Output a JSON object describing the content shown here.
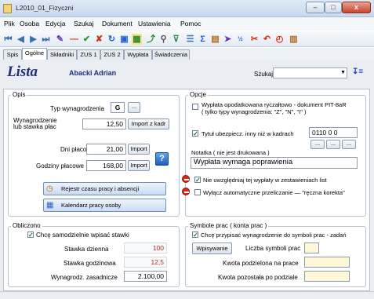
{
  "window": {
    "title": "L2010_01_Fizyczni"
  },
  "menu": [
    "Plik",
    "Osoba",
    "Edycja",
    "Szukaj",
    "Dokument",
    "Ustawienia",
    "Pomoc"
  ],
  "tabs": [
    "Spis",
    "Ogólne",
    "Składniki",
    "ZUS 1",
    "ZUS 2",
    "Wypłata",
    "Świadczenia"
  ],
  "header": {
    "logo": "Lista",
    "person": "Abacki Adrian",
    "search_label": "Szukaj",
    "search_value": ""
  },
  "opis": {
    "title": "Opis",
    "typ_label": "Typ wynagrodzenia",
    "typ_value": "G",
    "ellipsis": "...",
    "wyn_label1": "Wynagrodzenie",
    "wyn_label2": "lub stawka płac",
    "wyn_value": "12,50",
    "import_kadr": "Import z kadr",
    "dni_label": "Dni płacowe",
    "dni_value": "21,00",
    "import": "Import",
    "godz_label": "Godziny płacowe",
    "godz_value": "168,00",
    "help": "?",
    "rejestr": "Rejestr czasu pracy i absencji",
    "kalendarz": "Kalendarz pracy osoby"
  },
  "opcje": {
    "title": "Opcje",
    "ryczalt1": "Wypłata opodatkowana ryczałtowo - dokument PIT-8aR",
    "ryczalt2": "( tylko typy wynagrodzenia: \"Z\", \"N\", \"I\" )",
    "tytul1": "Tytuł ubezpiecz. inny niż w kadrach",
    "tytul_value": "0110  0  0",
    "notatka_label": "Notatka ( nie jest drukowana )",
    "notatka_value": "Wypłata wymaga poprawienia",
    "nie_uwzgl": "Nie uwzględniaj tej wypłaty w zestawieniach list",
    "wylacz": "Wyłącz automatyczne przeliczanie  — \"ręczna korekta\""
  },
  "obliczono": {
    "title": "Obliczono",
    "chk": "Chcę samodzielnie wpisać stawki",
    "dzienna_label": "Stawka dzienna",
    "dzienna_value": "100",
    "godz_label": "Stawka godzinowa",
    "godz_value": "12,5",
    "zasad_label": "Wynagrodz. zasadnicze",
    "zasad_value": "2.100,00"
  },
  "symbole": {
    "title": "Symbole prac ( konta prac )",
    "chk": "Chcę przypisać wynagrodzenie do symboli prac - zadań",
    "wpisywanie": "Wpisywanie",
    "liczba_label": "Liczba symboli prac",
    "kwota_podz": "Kwota podzielona na prace",
    "kwota_poz": "Kwota pozostała po podziale"
  },
  "colors": {
    "accent": "#1f2f7a",
    "alert": "#c0261b"
  }
}
